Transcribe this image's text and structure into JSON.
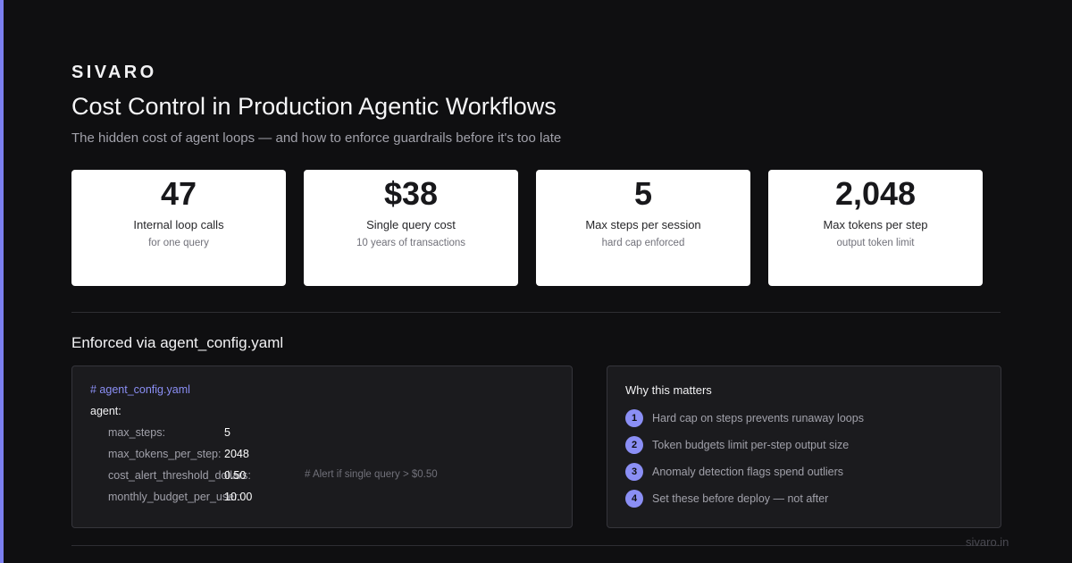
{
  "brand": "SIVARO",
  "title": "Cost Control in Production Agentic Workflows",
  "subtitle": "The hidden cost of agent loops — and how to enforce guardrails before it's too late",
  "stats": [
    {
      "value": "47",
      "label": "Internal loop calls",
      "note": "for one query"
    },
    {
      "value": "$38",
      "label": "Single query cost",
      "note": "10 years of transactions"
    },
    {
      "value": "5",
      "label": "Max steps per session",
      "note": "hard cap enforced"
    },
    {
      "value": "2,048",
      "label": "Max tokens per step",
      "note": "output token limit"
    }
  ],
  "section_title": "Enforced via agent_config.yaml",
  "config": {
    "comment": "# agent_config.yaml",
    "root": "agent:",
    "lines": [
      {
        "key": "max_steps:",
        "value": "5",
        "note": ""
      },
      {
        "key": "max_tokens_per_step:",
        "value": "2048",
        "note": ""
      },
      {
        "key": "cost_alert_threshold_dollars:",
        "value": "0.50",
        "note": "# Alert if single query > $0.50"
      },
      {
        "key": "monthly_budget_per_user:",
        "value": "10.00",
        "note": ""
      }
    ]
  },
  "why": {
    "title": "Why this matters",
    "items": [
      {
        "num": "1",
        "text": "Hard cap on steps prevents runaway loops"
      },
      {
        "num": "2",
        "text": "Token budgets limit per-step output size"
      },
      {
        "num": "3",
        "text": "Anomaly detection flags spend outliers"
      },
      {
        "num": "4",
        "text": "Set these before deploy — not after"
      }
    ]
  },
  "footer_url": "sivaro.in",
  "colors": {
    "accent": "#7b7ff0",
    "background": "#0f0f11",
    "card": "#ffffff"
  }
}
